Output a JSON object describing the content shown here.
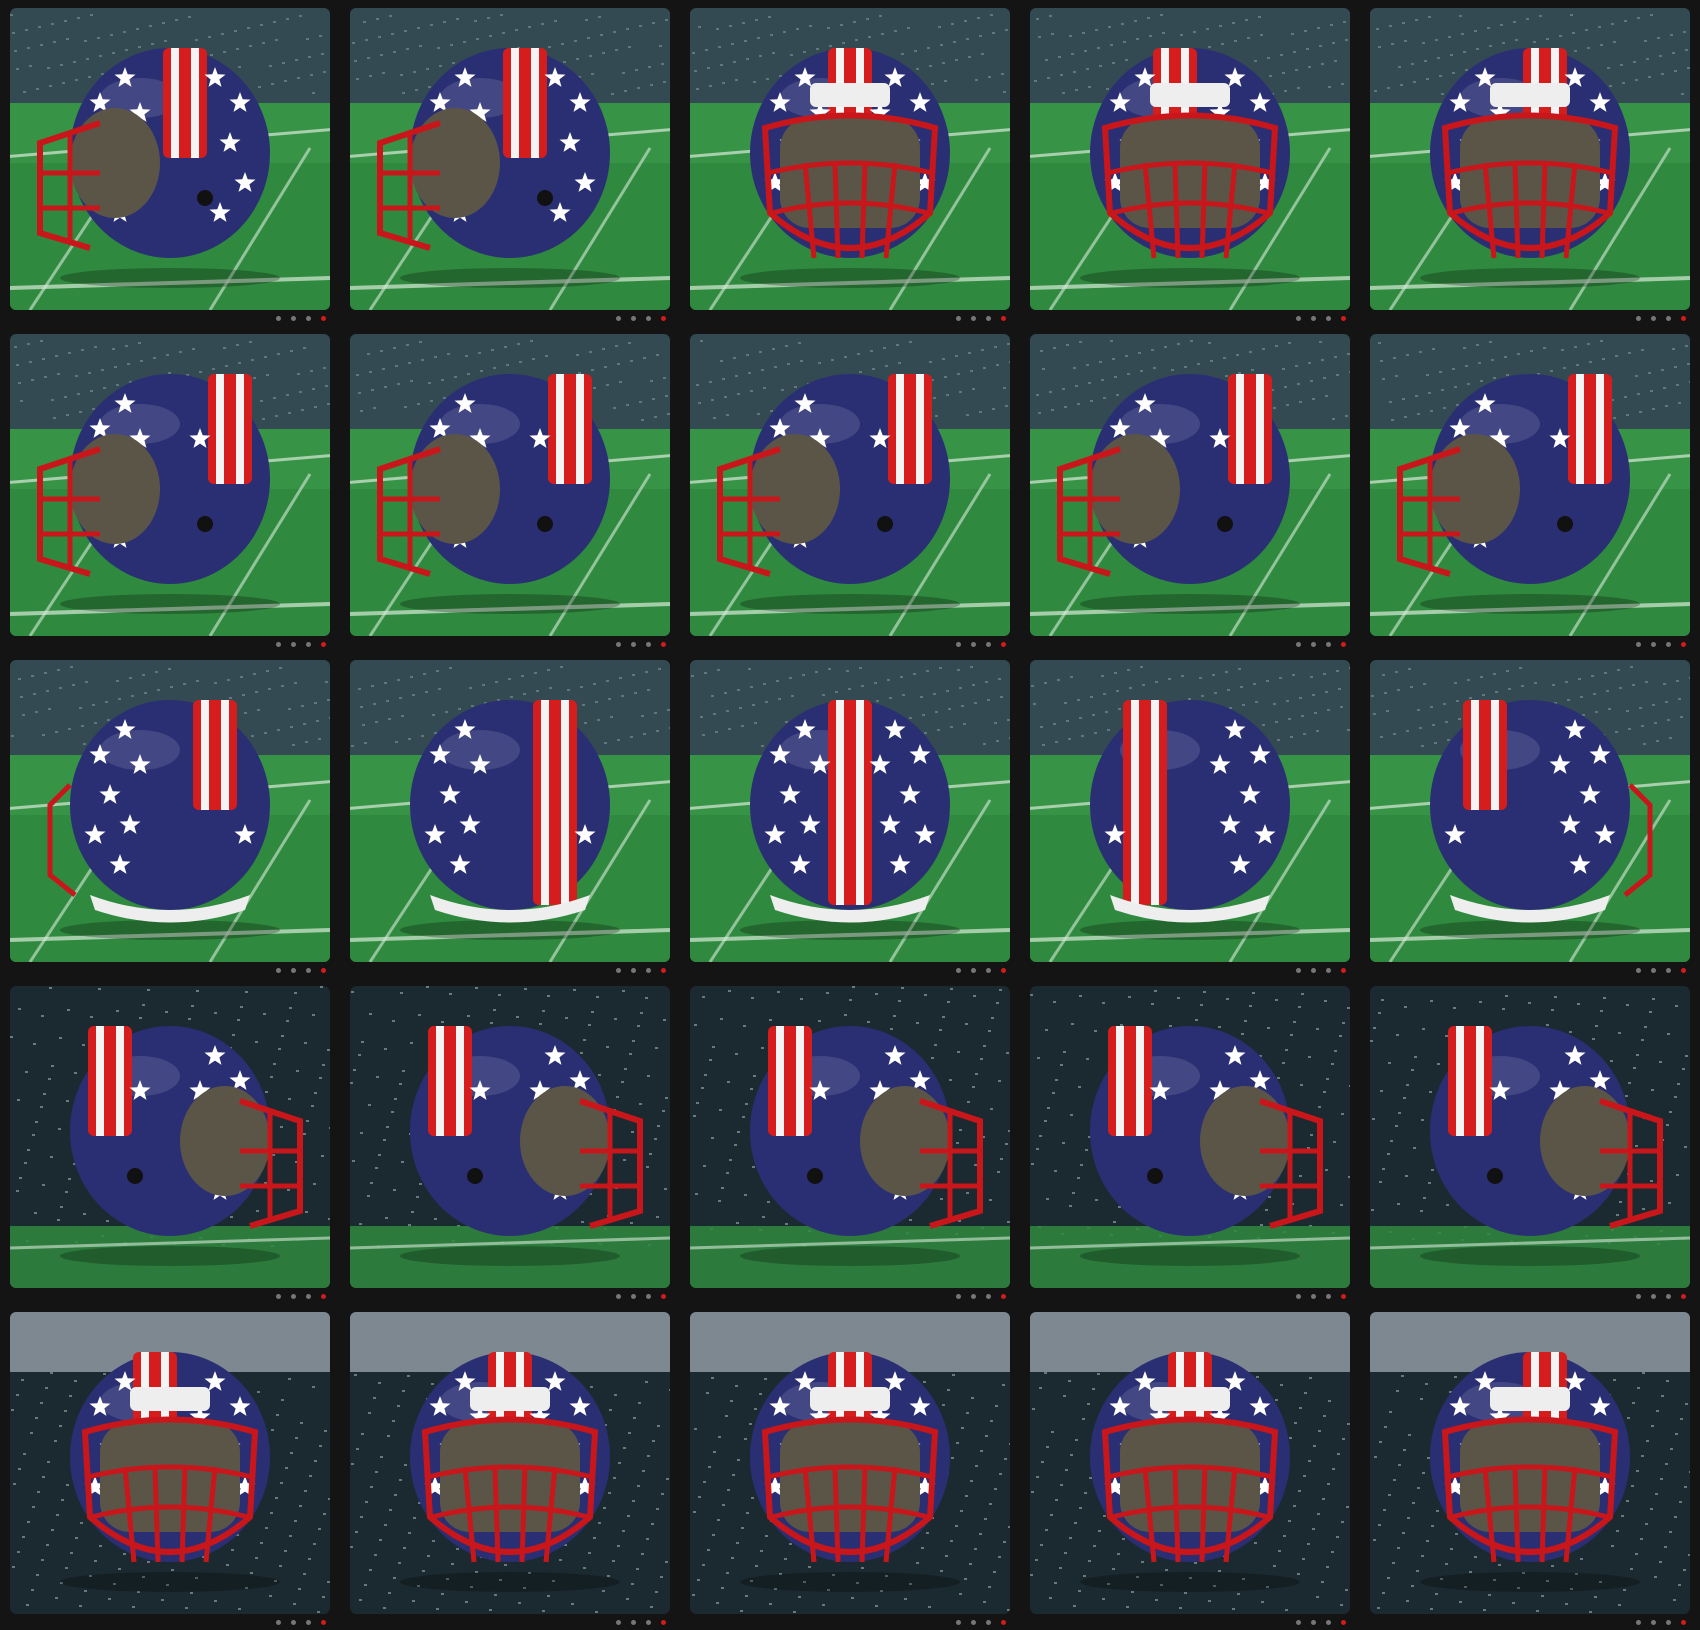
{
  "image": {
    "description_free": true,
    "colors": {
      "shell": "#2a2f73",
      "stripe_red": "#d61d1d",
      "stripe_white": "#f4f4f4",
      "facemask": "#c9161b",
      "field": "#2f8a3f",
      "stands": "#334a52",
      "stands_dark": "#1b2a30",
      "sky_light": "#cfd6e0"
    },
    "grid": {
      "rows": 5,
      "cols": 5
    },
    "views": [
      {
        "view": "front-left",
        "bg": "field",
        "mask": "left"
      },
      {
        "view": "front-left-2",
        "bg": "field",
        "mask": "left"
      },
      {
        "view": "front",
        "bg": "field",
        "mask": "front"
      },
      {
        "view": "front-right",
        "bg": "field",
        "mask": "front"
      },
      {
        "view": "front-left-3",
        "bg": "field",
        "mask": "front"
      },
      {
        "view": "left-front",
        "bg": "field",
        "mask": "left"
      },
      {
        "view": "left",
        "bg": "field",
        "mask": "left"
      },
      {
        "view": "left-side",
        "bg": "field",
        "mask": "left"
      },
      {
        "view": "left-back",
        "bg": "field",
        "mask": "left"
      },
      {
        "view": "left-back-2",
        "bg": "field",
        "mask": "left"
      },
      {
        "view": "back-left",
        "bg": "field",
        "mask": "left-small"
      },
      {
        "view": "back-left-2",
        "bg": "field",
        "mask": "none"
      },
      {
        "view": "back",
        "bg": "field",
        "mask": "none"
      },
      {
        "view": "back-right",
        "bg": "field",
        "mask": "none"
      },
      {
        "view": "back-right-2",
        "bg": "field",
        "mask": "right-small"
      },
      {
        "view": "right-back",
        "bg": "stadium",
        "mask": "right"
      },
      {
        "view": "right",
        "bg": "stadium",
        "mask": "right"
      },
      {
        "view": "right-side",
        "bg": "stadium",
        "mask": "right"
      },
      {
        "view": "right-front",
        "bg": "stadium",
        "mask": "right"
      },
      {
        "view": "right-front-2",
        "bg": "stadium",
        "mask": "right"
      },
      {
        "view": "front-right-low",
        "bg": "lights",
        "mask": "front"
      },
      {
        "view": "front-low",
        "bg": "lights",
        "mask": "front"
      },
      {
        "view": "front-low-2",
        "bg": "lights",
        "mask": "front"
      },
      {
        "view": "front-low-3",
        "bg": "lights",
        "mask": "front"
      },
      {
        "view": "front-left-low",
        "bg": "lights",
        "mask": "front"
      }
    ]
  }
}
